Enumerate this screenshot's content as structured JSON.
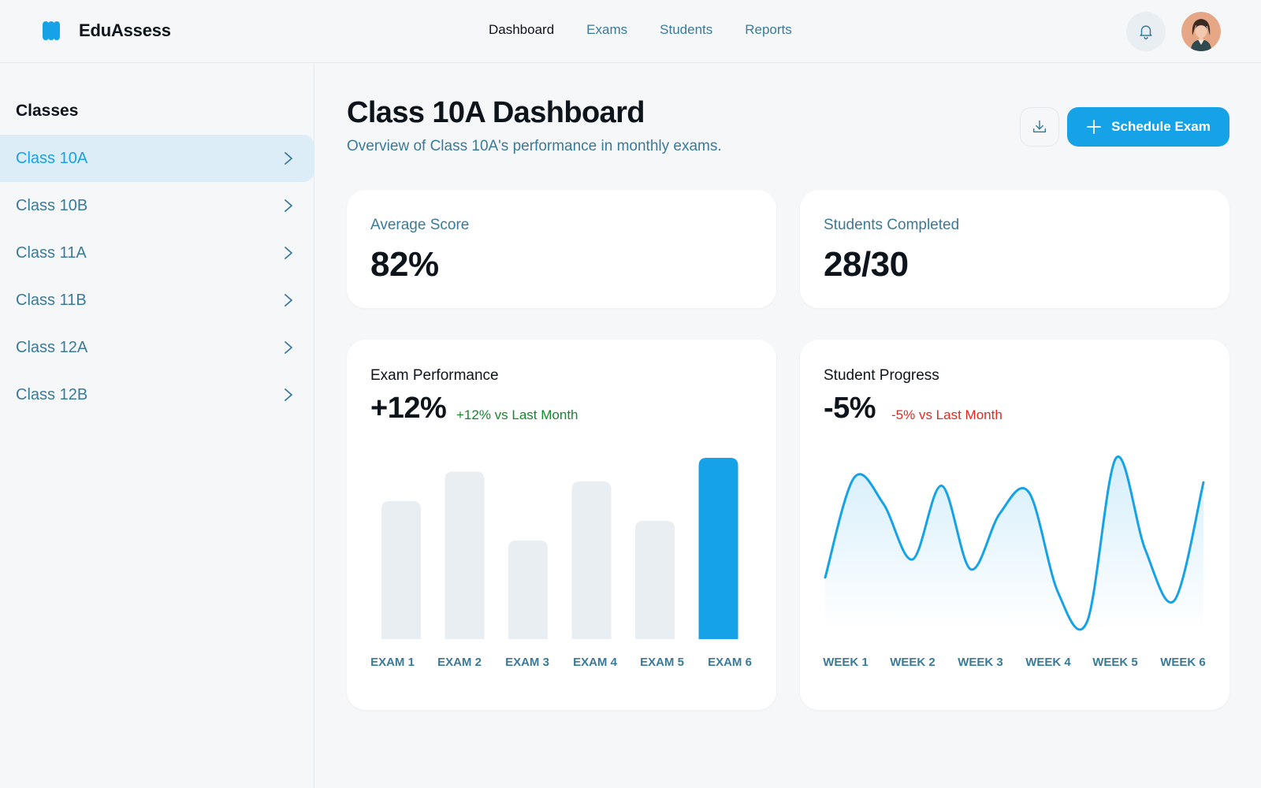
{
  "app": {
    "name": "EduAssess"
  },
  "nav": {
    "items": [
      {
        "label": "Dashboard",
        "active": true
      },
      {
        "label": "Exams",
        "active": false
      },
      {
        "label": "Students",
        "active": false
      },
      {
        "label": "Reports",
        "active": false
      }
    ]
  },
  "sidebar": {
    "title": "Classes",
    "items": [
      {
        "label": "Class 10A",
        "active": true
      },
      {
        "label": "Class 10B",
        "active": false
      },
      {
        "label": "Class 11A",
        "active": false
      },
      {
        "label": "Class 11B",
        "active": false
      },
      {
        "label": "Class 12A",
        "active": false
      },
      {
        "label": "Class 12B",
        "active": false
      }
    ]
  },
  "header": {
    "title": "Class 10A Dashboard",
    "subtitle": "Overview of Class 10A's performance in monthly exams.",
    "schedule_label": "Schedule Exam"
  },
  "stats": {
    "average": {
      "label": "Average Score",
      "value": "82%"
    },
    "completed": {
      "label": "Students Completed",
      "value": "28/30"
    }
  },
  "icons": {
    "logo": "brand-logo-icon",
    "bell": "bell-icon",
    "download": "download-icon",
    "plus": "plus-icon",
    "chevron": "chevron-right-icon"
  },
  "colors": {
    "accent": "#16a2e6",
    "muted_text": "#3a7a99",
    "bar_inactive": "#e8eef1",
    "positive": "#118a2c",
    "negative": "#e02a1f"
  },
  "chart_data": [
    {
      "type": "bar",
      "title": "Exam Performance",
      "headline": "+12%",
      "delta": "+12% vs Last Month",
      "categories": [
        "EXAM 1",
        "EXAM 2",
        "EXAM 3",
        "EXAM 4",
        "EXAM 5",
        "EXAM 6"
      ],
      "values": [
        70,
        85,
        50,
        80,
        60,
        92
      ],
      "highlight_index": 5,
      "ylim": [
        0,
        100
      ],
      "grid": false
    },
    {
      "type": "area",
      "title": "Student Progress",
      "headline": "-5%",
      "delta": "-5% vs Last Month",
      "categories": [
        "WEEK 1",
        "WEEK 2",
        "WEEK 3",
        "WEEK 4",
        "WEEK 5",
        "WEEK 6"
      ],
      "x": [
        0,
        0.5,
        1,
        1.5,
        2,
        2.5,
        3,
        3.5,
        4,
        4.5,
        5,
        5.5,
        6,
        6.5,
        7,
        7.5,
        8,
        8.5,
        9,
        9.5,
        10
      ],
      "values": [
        27,
        88,
        72,
        38,
        83,
        32,
        66,
        79,
        18,
        0,
        100,
        44,
        13,
        85
      ],
      "ylim": [
        0,
        100
      ],
      "grid": false
    }
  ]
}
